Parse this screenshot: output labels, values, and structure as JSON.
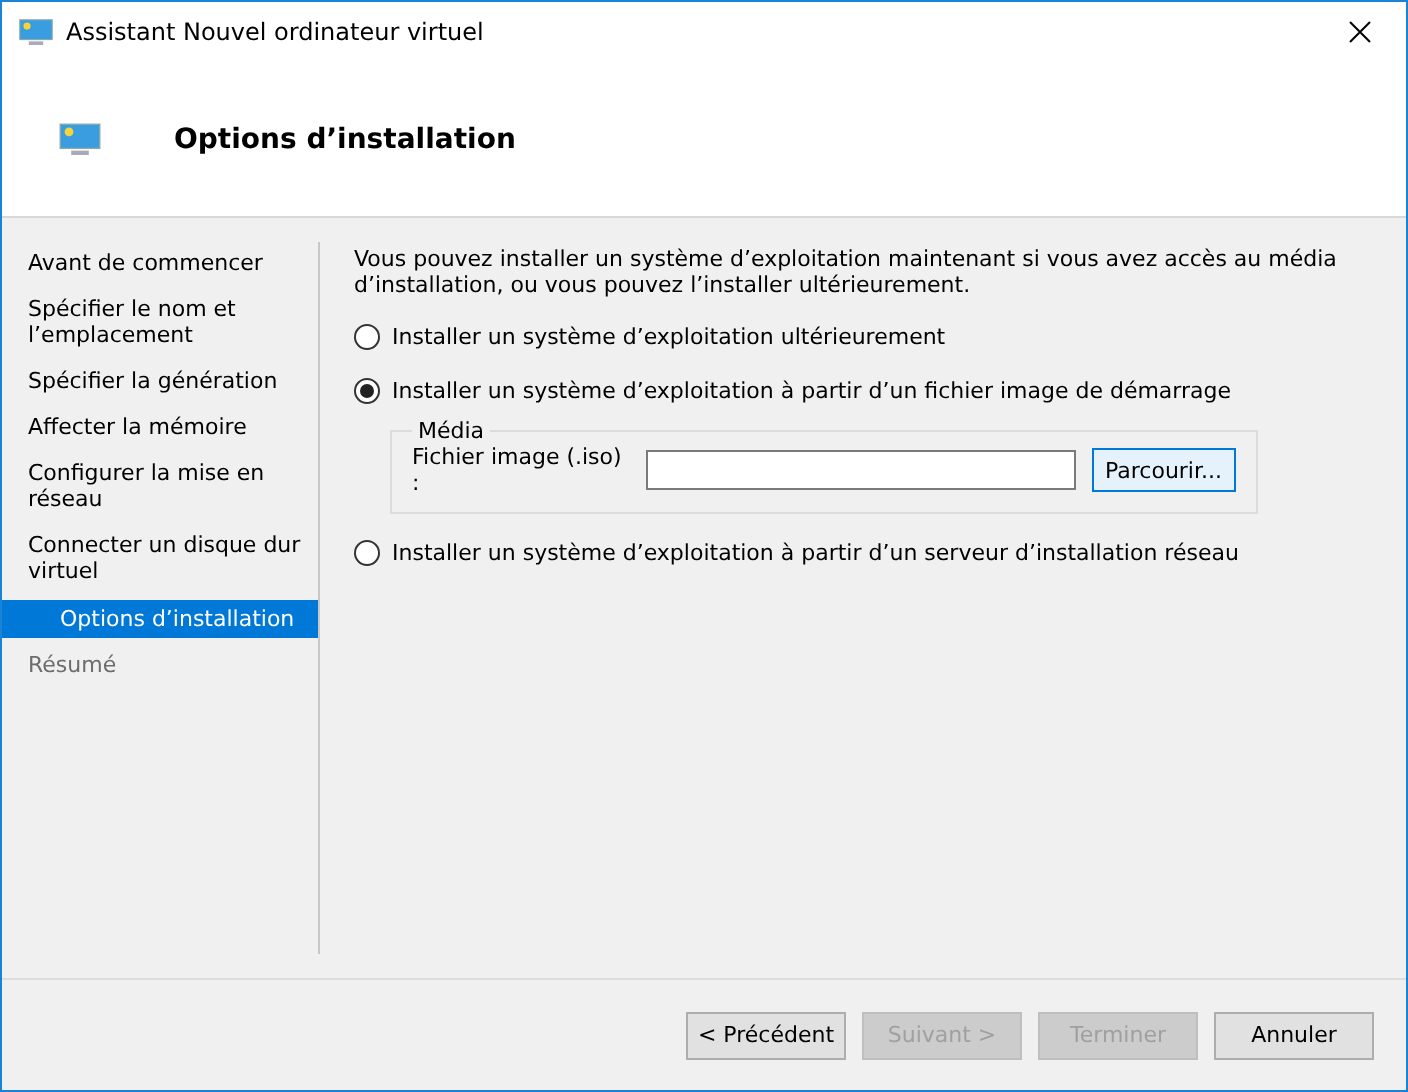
{
  "window": {
    "title": "Assistant Nouvel ordinateur virtuel"
  },
  "header": {
    "title": "Options d’installation"
  },
  "sidebar": {
    "items": [
      {
        "label": "Avant de commencer",
        "selected": false,
        "disabled": false
      },
      {
        "label": "Spécifier le nom et l’emplacement",
        "selected": false,
        "disabled": false
      },
      {
        "label": "Spécifier la génération",
        "selected": false,
        "disabled": false
      },
      {
        "label": "Affecter la mémoire",
        "selected": false,
        "disabled": false
      },
      {
        "label": "Configurer la mise en réseau",
        "selected": false,
        "disabled": false
      },
      {
        "label": "Connecter un disque dur virtuel",
        "selected": false,
        "disabled": false
      },
      {
        "label": "Options d’installation",
        "selected": true,
        "disabled": false
      },
      {
        "label": "Résumé",
        "selected": false,
        "disabled": true
      }
    ]
  },
  "intro": "Vous pouvez installer un système d’exploitation maintenant si vous avez accès au média d’installation, ou vous pouvez l’installer ultérieurement.",
  "options": [
    {
      "label": "Installer un système d’exploitation ultérieurement",
      "selected": false
    },
    {
      "label": "Installer un système d’exploitation à partir d’un fichier image de démarrage",
      "selected": true
    },
    {
      "label": "Installer un système d’exploitation à partir d’un serveur d’installation réseau",
      "selected": false
    }
  ],
  "media": {
    "title": "Média",
    "field_label": "Fichier image (.iso) :",
    "browse": "Parcourir..."
  },
  "buttons": [
    {
      "label": "< Précédent",
      "disabled": false
    },
    {
      "label": "Suivant >",
      "disabled": true
    },
    {
      "label": "Terminer",
      "disabled": true
    },
    {
      "label": "Annuler",
      "disabled": false
    }
  ]
}
